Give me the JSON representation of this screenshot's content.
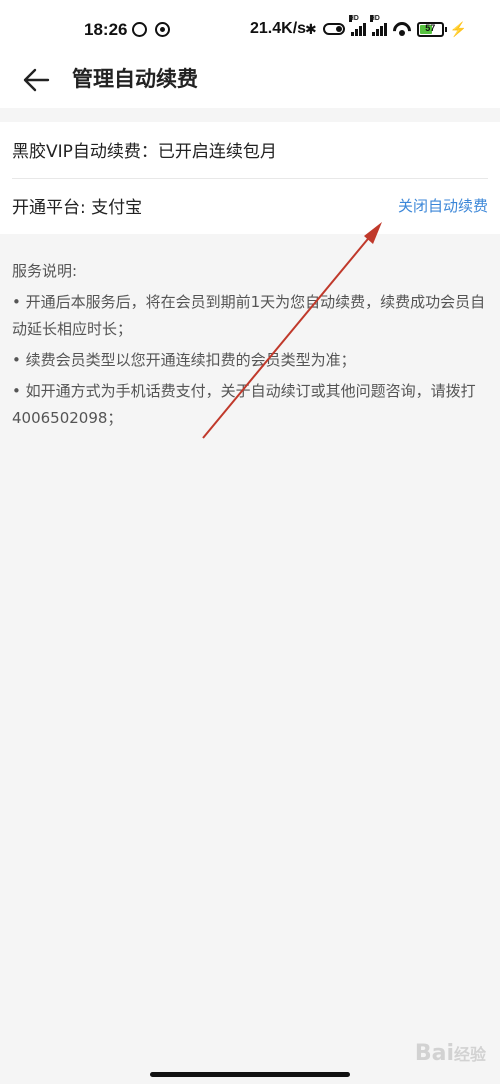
{
  "status": {
    "time": "18:26",
    "speed": "21.4K/s",
    "hd1": "HD",
    "hd2": "HD",
    "battery": "57",
    "battery_level_percent": 57
  },
  "header": {
    "title": "管理自动续费"
  },
  "card": {
    "vip_status": "黑胶VIP自动续费：已开启连续包月",
    "platform": "开通平台: 支付宝",
    "close_link": "关闭自动续费"
  },
  "notes": {
    "heading": "服务说明:",
    "items": [
      "• 开通后本服务后，将在会员到期前1天为您自动续费，续费成功会员自动延长相应时长；",
      "• 续费会员类型以您开通连续扣费的会员类型为准；",
      "• 如开通方式为手机话费支付，关于自动续订或其他问题咨询，请拨打4006502098；"
    ]
  },
  "colors": {
    "link": "#3c87d8",
    "annotation_arrow": "#c0392b",
    "battery_fill": "#57c240"
  },
  "watermark": {
    "text": "Bai 经验"
  }
}
